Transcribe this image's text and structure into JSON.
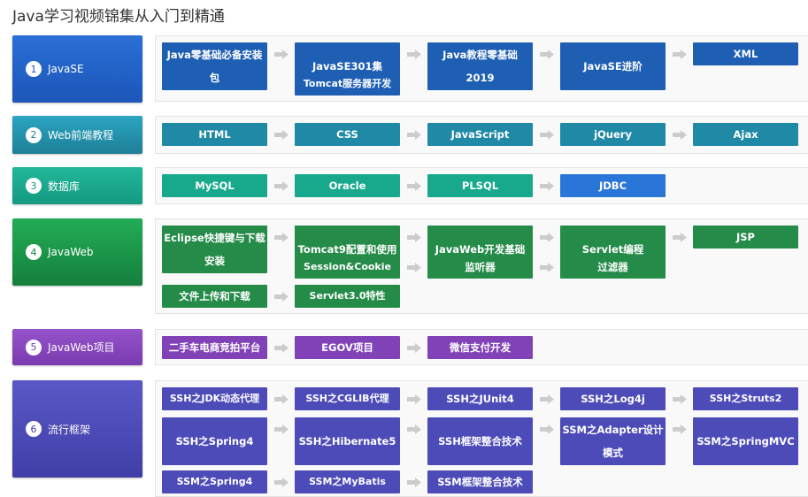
{
  "page": {
    "title": "Java学习视频锦集从入门到精通"
  },
  "sections": [
    {
      "number": "1",
      "name": "JavaSE",
      "label_color": "#2a6fd6",
      "label_color_2": "#1c56b8",
      "button_color": "#1e5fb4",
      "rows": [
        [
          "Java零基础必备安装包",
          "JavaSE301集",
          "Java教程零基础2019",
          "JavaSE进阶",
          "XML"
        ],
        [
          null,
          "Tomcat服务器开发"
        ]
      ]
    },
    {
      "number": "2",
      "name": "Web前端教程",
      "label_color": "#2aa5c2",
      "label_color_2": "#1f7f98",
      "button_color": "#1f89a6",
      "rows": [
        [
          "HTML",
          "CSS",
          "JavaScript",
          "jQuery",
          "Ajax"
        ]
      ]
    },
    {
      "number": "3",
      "name": "数据库",
      "label_color": "#22b79a",
      "label_color_2": "#149a80",
      "button_color": "#18a98d",
      "extra_colors": {
        "JDBC": "#2a76d8"
      },
      "rows": [
        [
          "MySQL",
          "Oracle",
          "PLSQL",
          "JDBC"
        ]
      ]
    },
    {
      "number": "4",
      "name": "JavaWeb",
      "label_color": "#22ad55",
      "label_color_2": "#157f3d",
      "button_color": "#248b48",
      "rows": [
        [
          "Eclipse快捷键与下载安装",
          "Tomcat9配置和使用",
          "JavaWeb开发基础",
          "Servlet编程",
          "JSP"
        ],
        [
          null,
          "Session&Cookie",
          "监听器",
          "过滤器"
        ],
        [
          "文件上传和下载",
          "Servlet3.0特性"
        ]
      ]
    },
    {
      "number": "5",
      "name": "JavaWeb项目",
      "label_color": "#9553c9",
      "label_color_2": "#7a3ab0",
      "button_color": "#8142b8",
      "rows": [
        [
          "二手车电商竞拍平台",
          "EGOV项目",
          "微信支付开发"
        ]
      ]
    },
    {
      "number": "6",
      "name": "流行框架",
      "label_color": "#5a58c6",
      "label_color_2": "#403ea6",
      "button_color": "#4d4bb8",
      "rows": [
        [
          "SSH之JDK动态代理",
          "SSH之CGLIB代理",
          "SSH之JUnit4",
          "SSH之Log4j",
          "SSH之Struts2"
        ],
        [
          "SSH之Spring4",
          "SSH之Hibernate5",
          "SSH框架整合技术",
          "SSM之Adapter设计模式",
          "SSM之SpringMVC"
        ],
        [
          "SSM之Spring4",
          "SSM之MyBatis",
          "SSM框架整合技术"
        ]
      ]
    }
  ],
  "colors": {
    "arrow": "#cccccc",
    "panel_bg": "#f9f9f9"
  },
  "icons": {
    "arrow": "arrow-right-icon"
  }
}
